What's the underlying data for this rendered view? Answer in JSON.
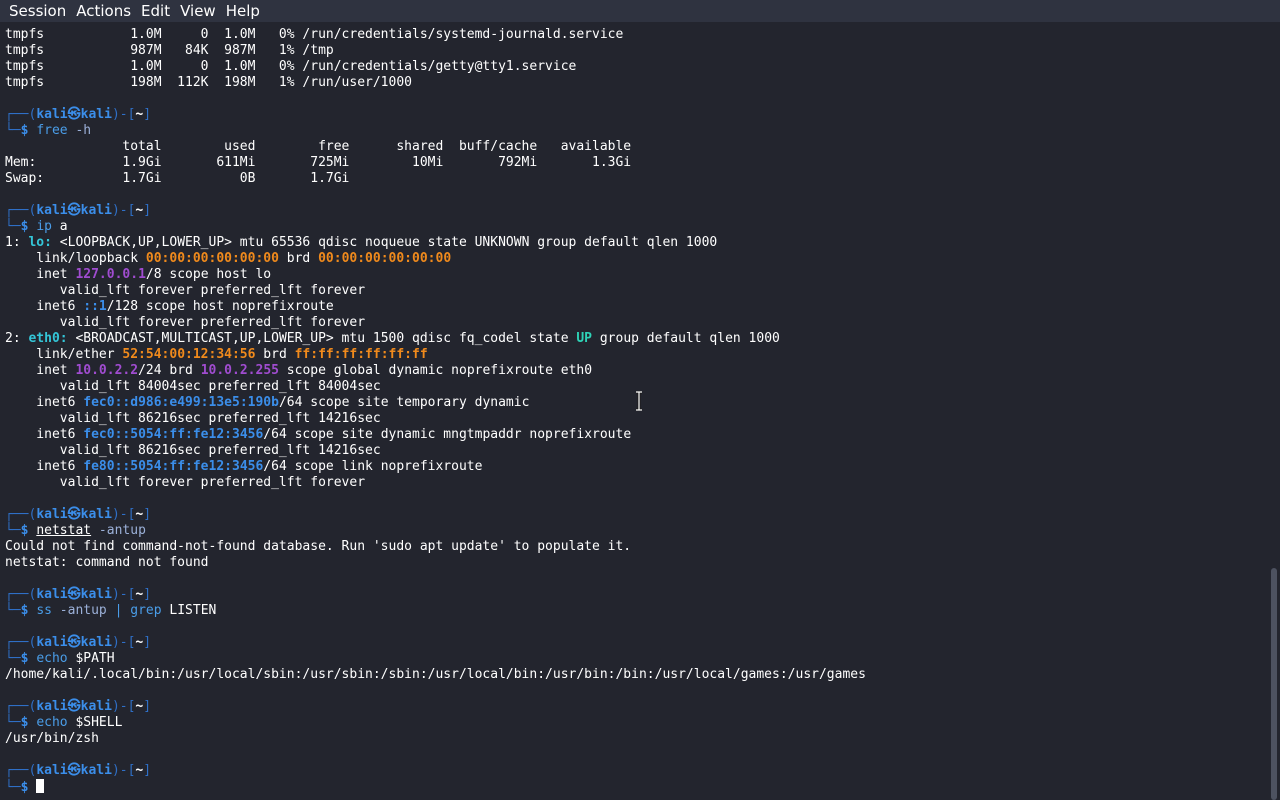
{
  "menu": [
    "Session",
    "Actions",
    "Edit",
    "View",
    "Help"
  ],
  "prompt": {
    "top_left": "┌──(",
    "user": "kali㉿kali",
    "mid": ")-[",
    "dir": "~",
    "end": "]",
    "bottom": "└─",
    "dollar": "$"
  },
  "df_rows": [
    "tmpfs           1.0M     0  1.0M   0% /run/credentials/systemd-journald.service",
    "tmpfs           987M   84K  987M   1% /tmp",
    "tmpfs           1.0M     0  1.0M   0% /run/credentials/getty@tty1.service",
    "tmpfs           198M  112K  198M   1% /run/user/1000"
  ],
  "free": {
    "cmd": "free",
    "args": " -h",
    "header": "               total        used        free      shared  buff/cache   available",
    "mem": "Mem:           1.9Gi       611Mi       725Mi        10Mi       792Mi       1.3Gi",
    "swap": "Swap:          1.7Gi          0B       1.7Gi"
  },
  "ip": {
    "cmd": "ip",
    "args": " a",
    "lo_num": "1: ",
    "lo_name": "lo:",
    "lo_rest": " <LOOPBACK,UP,LOWER_UP> mtu 65536 qdisc noqueue state UNKNOWN group default qlen 1000",
    "lo_link_a": "    link/loopback ",
    "lo_mac": "00:00:00:00:00:00",
    "lo_link_b": " brd ",
    "lo_brd": "00:00:00:00:00:00",
    "lo_inet_a": "    inet ",
    "lo_ip4": "127.0.0.1",
    "lo_inet_b": "/8 scope host lo",
    "valid_forever": "       valid_lft forever preferred_lft forever",
    "lo_inet6_a": "    inet6 ",
    "lo_ip6": "::1",
    "lo_inet6_b": "/128 scope host noprefixroute",
    "eth_num": "2: ",
    "eth_name": "eth0:",
    "eth_rest_a": " <BROADCAST,MULTICAST,UP,LOWER_UP> mtu 1500 qdisc fq_codel state ",
    "eth_state": "UP",
    "eth_rest_b": " group default qlen 1000",
    "eth_link_a": "    link/ether ",
    "eth_mac": "52:54:00:12:34:56",
    "eth_link_b": " brd ",
    "eth_brd": "ff:ff:ff:ff:ff:ff",
    "eth_inet_a": "    inet ",
    "eth_ip4": "10.0.2.2",
    "eth_inet_b": "/24 brd ",
    "eth_brd4": "10.0.2.255",
    "eth_inet_c": " scope global dynamic noprefixroute eth0",
    "valid_84004": "       valid_lft 84004sec preferred_lft 84004sec",
    "inet6_label": "    inet6 ",
    "eth_ip6a": "fec0::d986:e499:13e5:190b",
    "eth_ip6a_rest": "/64 scope site temporary dynamic",
    "valid_86216": "       valid_lft 86216sec preferred_lft 14216sec",
    "eth_ip6b": "fec0::5054:ff:fe12:3456",
    "eth_ip6b_rest": "/64 scope site dynamic mngtmpaddr noprefixroute",
    "eth_ip6c": "fe80::5054:ff:fe12:3456",
    "eth_ip6c_rest": "/64 scope link noprefixroute"
  },
  "netstat": {
    "cmd": "netstat",
    "args": " -antup",
    "out1": "Could not find command-not-found database. Run 'sudo apt update' to populate it.",
    "out2": "netstat: command not found"
  },
  "ss": {
    "cmd": "ss",
    "args": " -antup ",
    "pipe": "|",
    "cmd2": " grep",
    "args2": " LISTEN"
  },
  "echo_path": {
    "cmd": "echo",
    "args": " $PATH",
    "out": "/home/kali/.local/bin:/usr/local/sbin:/usr/sbin:/sbin:/usr/local/bin:/usr/bin:/bin:/usr/local/games:/usr/games"
  },
  "echo_shell": {
    "cmd": "echo",
    "args": " $SHELL",
    "out": "/usr/bin/zsh"
  }
}
